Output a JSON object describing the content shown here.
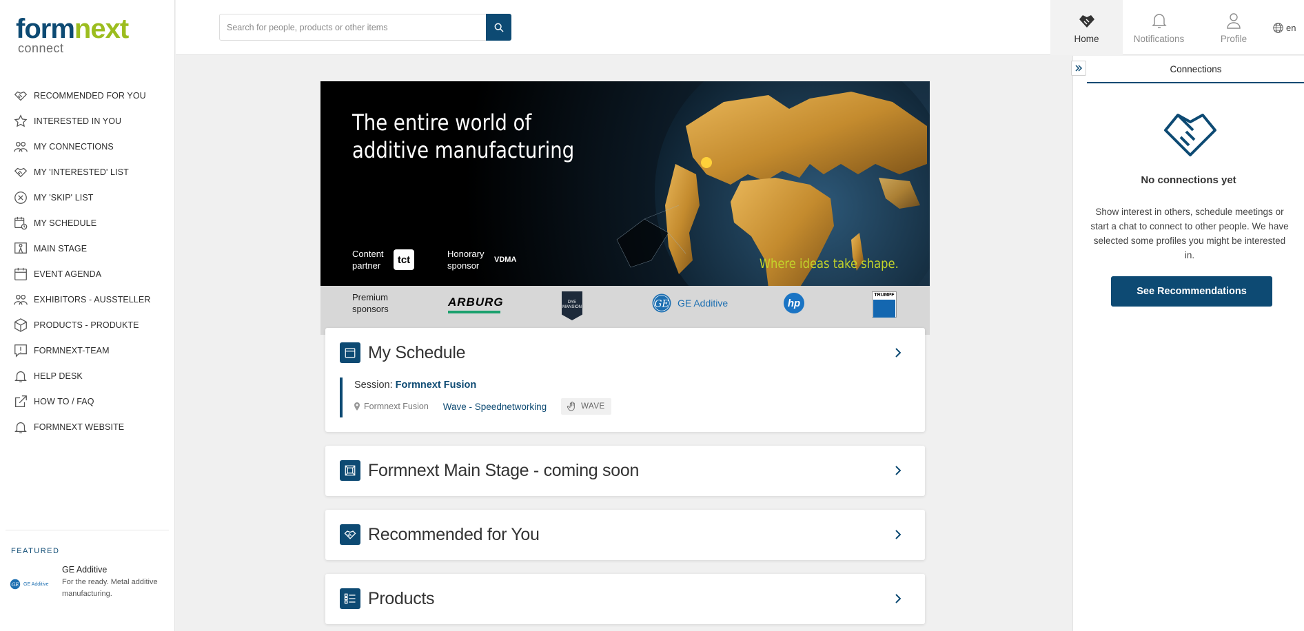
{
  "app": {
    "logo_primary_a": "form",
    "logo_primary_b": "next",
    "logo_secondary": "connect"
  },
  "sidebar": {
    "items": [
      {
        "label": "RECOMMENDED FOR YOU",
        "icon": "handshake-icon"
      },
      {
        "label": "INTERESTED IN YOU",
        "icon": "star-icon"
      },
      {
        "label": "MY CONNECTIONS",
        "icon": "people-icon"
      },
      {
        "label": "MY 'INTERESTED' LIST",
        "icon": "handshake-icon"
      },
      {
        "label": "MY 'SKIP' LIST",
        "icon": "x-circle-icon"
      },
      {
        "label": "MY SCHEDULE",
        "icon": "calendar-clock-icon"
      },
      {
        "label": "MAIN STAGE",
        "icon": "stage-icon"
      },
      {
        "label": "EVENT AGENDA",
        "icon": "calendar-icon"
      },
      {
        "label": "EXHIBITORS - AUSSTELLER",
        "icon": "people-icon"
      },
      {
        "label": "PRODUCTS - PRODUKTE",
        "icon": "box-icon"
      },
      {
        "label": "FORMNEXT-TEAM",
        "icon": "alert-chat-icon"
      },
      {
        "label": "HELP DESK",
        "icon": "bell-icon"
      },
      {
        "label": "HOW TO / FAQ",
        "icon": "external-link-icon"
      },
      {
        "label": "FORMNEXT WEBSITE",
        "icon": "bell-icon"
      }
    ],
    "featured": {
      "title": "FEATURED",
      "logo_text": "GE Additive",
      "name": "GE Additive",
      "description": "For the ready. Metal additive manufacturing."
    }
  },
  "header": {
    "search_placeholder": "Search for people, products or other items",
    "nav": {
      "home": "Home",
      "notifications": "Notifications",
      "profile": "Profile",
      "language": "en"
    }
  },
  "banner": {
    "headline_line1": "The entire world of",
    "headline_line2": "additive manufacturing",
    "content_partner_label": "Content partner",
    "content_partner_logo": "tct",
    "honorary_sponsor_label": "Honorary sponsor",
    "honorary_sponsor_logo": "VDMA",
    "tagline": "Where ideas take shape.",
    "premium_sponsors_label": "Premium sponsors",
    "sponsors": {
      "arburg": "ARBURG",
      "dyemansion": "DYE MANSION",
      "ge": "GE Additive",
      "trumpf": "TRUMPF"
    }
  },
  "cards": {
    "schedule": {
      "title": "My Schedule",
      "session_prefix": "Session:",
      "session_name": "Formnext Fusion",
      "location": "Formnext Fusion",
      "session_link": "Wave - Speednetworking",
      "tag": "WAVE"
    },
    "main_stage": {
      "title": "Formnext Main Stage - coming soon"
    },
    "recommended": {
      "title": "Recommended for You"
    },
    "products": {
      "title": "Products"
    }
  },
  "right_panel": {
    "tab": "Connections",
    "empty_title": "No connections yet",
    "empty_desc": "Show interest in others, schedule meetings or start a chat to connect to other people. We have selected some profiles you might be interested in.",
    "button": "See Recommendations"
  },
  "colors": {
    "brand_blue": "#0d4a73",
    "brand_green": "#9cbd1f",
    "tagline_green": "#c4d42a"
  }
}
